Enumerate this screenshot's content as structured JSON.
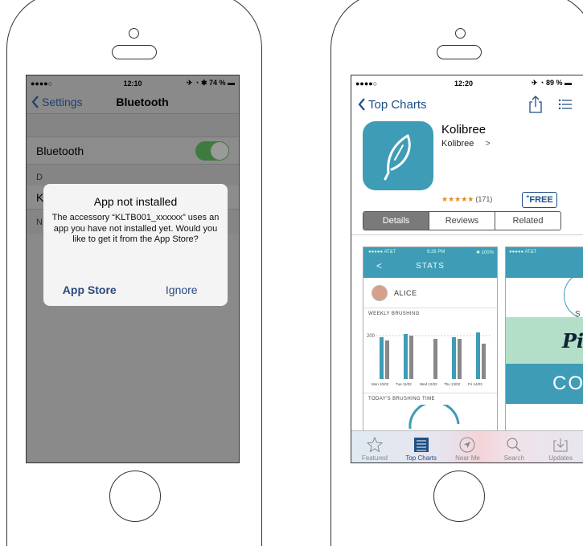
{
  "phone1": {
    "status": {
      "carrier": "●●●●○",
      "time": "12:10",
      "right": "✈ ◔ ✱ 74 % ▬"
    },
    "nav": {
      "back_label": "Settings",
      "title": "Bluetooth"
    },
    "bluetooth_row_label": "Bluetooth",
    "section_devices": "D",
    "device_row": "K",
    "section_now": "N",
    "dialog": {
      "title": "App not installed",
      "message": "The accessory “KLTB001_xxxxxx” uses an app you have not installed yet. Would you like to get it from the App Store?",
      "primary": "App Store",
      "secondary": "Ignore"
    }
  },
  "phone2": {
    "status": {
      "carrier": "●●●●○",
      "time": "12:20",
      "right": "✈ ◔ 89 % ▬"
    },
    "nav": {
      "back_label": "Top Charts"
    },
    "app": {
      "name": "Kolibree",
      "developer": "Kolibree",
      "developer_chevron": ">",
      "stars": "★★★★★",
      "rating_count": "(171)",
      "price_button": "FREE"
    },
    "segments": [
      "Details",
      "Reviews",
      "Related"
    ],
    "screenshot1": {
      "status_left": "●●●●● AT&T",
      "status_time": "9:26 PM",
      "status_right": "✱ 100%",
      "header": "STATS",
      "back": "<",
      "user": "ALICE",
      "weekly": "WEEKLY BRUSHING",
      "y_tick": "200",
      "days": [
        "Mon 10/02",
        "Tue 11/02",
        "Wed 12/02",
        "Thu 13/02",
        "Fri 14/02"
      ],
      "today": "TODAY'S BRUSHING TIME"
    },
    "screenshot2": {
      "status_left": "●●●●● AT&T",
      "letter_s": "S",
      "script_text": "Pi",
      "coa_text": "CO"
    },
    "tabs": [
      "Featured",
      "Top Charts",
      "Near Me",
      "Search",
      "Updates"
    ],
    "active_tab": "Top Charts",
    "colors": {
      "accent": "#1f4f86",
      "app_teal": "#3e9cb6",
      "star": "#e08a20"
    }
  }
}
